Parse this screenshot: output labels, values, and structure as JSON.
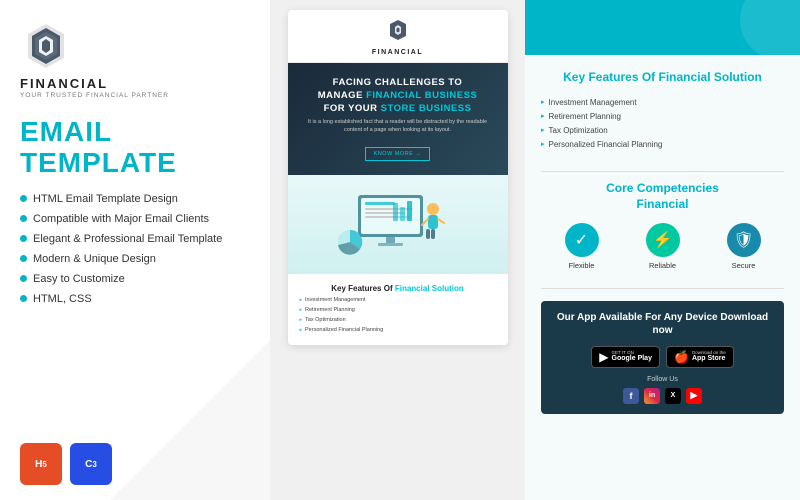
{
  "left": {
    "logo_name": "FINANCIAL",
    "logo_sub": "YOUR TRUSTED FINANCIAL PARTNER",
    "title_line1": "EMAIL",
    "title_line2": "TEMPLATE",
    "features": [
      "HTML Email Template Design",
      "Compatible with Major Email Clients",
      "Elegant & Professional Email Template",
      "Modern & Unique Design",
      "Easy to Customize",
      "HTML, CSS"
    ],
    "badge_html": "5",
    "badge_css": "3"
  },
  "middle": {
    "preview_logo_name": "FINANCIAL",
    "hero_line1": "FACING CHALLENGES TO",
    "hero_line2": "MANAGE",
    "hero_highlight1": "FINANCIAL BUSINESS",
    "hero_line3": "FOR YOUR",
    "hero_highlight2": "STORE BUSINESS",
    "hero_sub": "It is a long established fact that a reader will be distracted by the readable content of a page when looking at its layout.",
    "cta": "KNOW MORE →",
    "features_title": "Key Features Of",
    "features_highlight": "Financial Solution",
    "feature_items": [
      "Investment Management",
      "Retirement Planning",
      "Tax Optimization",
      "Personalized Financial Planning"
    ]
  },
  "right": {
    "key_features_title": "Key Features Of",
    "key_features_highlight": "Financial Solution",
    "features": [
      "Investment Management",
      "Retirement Planning",
      "Tax Optimization",
      "Personalized Financial Planning"
    ],
    "core_title": "Core Competencies",
    "core_highlight": "Financial",
    "competencies": [
      {
        "label": "Flexible",
        "icon": "✓"
      },
      {
        "label": "Reliable",
        "icon": "⚡"
      },
      {
        "label": "Secure",
        "icon": "🛡"
      }
    ],
    "app_title": "Our App Available For Any Device Download now",
    "google_play_sub": "GET IT ON",
    "google_play_main": "Google Play",
    "app_store_sub": "Download on the",
    "app_store_main": "App Store",
    "follow": "Follow Us",
    "socials": [
      "f",
      "in",
      "x",
      "▶"
    ]
  }
}
